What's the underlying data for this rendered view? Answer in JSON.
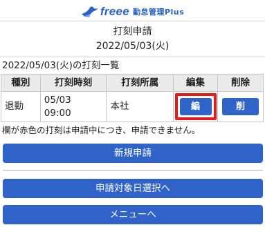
{
  "header": {
    "logo_word": "freee",
    "product_name": "勤怠管理Plus",
    "logo_icon": "bird-icon",
    "brand_color": "#2a63c4"
  },
  "page": {
    "title": "打刻申請",
    "date": "2022/05/03(火)",
    "list_heading": "2022/05/03(火)の打刻一覧"
  },
  "table": {
    "headers": [
      "種別",
      "打刻時刻",
      "打刻所属",
      "編集",
      "削除"
    ],
    "rows": [
      {
        "type": "退勤",
        "time_date": "05/03",
        "time_clock": "09:00",
        "affiliation": "本社",
        "edit_label": "編",
        "delete_label": "削"
      }
    ]
  },
  "note": "欄が赤色の打刻は申請中につき、申請できません。",
  "buttons": {
    "new_request": "新規申請",
    "select_date": "申請対象日選択へ",
    "menu": "メニューへ"
  },
  "colors": {
    "button_blue": "#2f63c8",
    "highlight_red": "#e8191b",
    "header_gray": "#eaeaea"
  }
}
